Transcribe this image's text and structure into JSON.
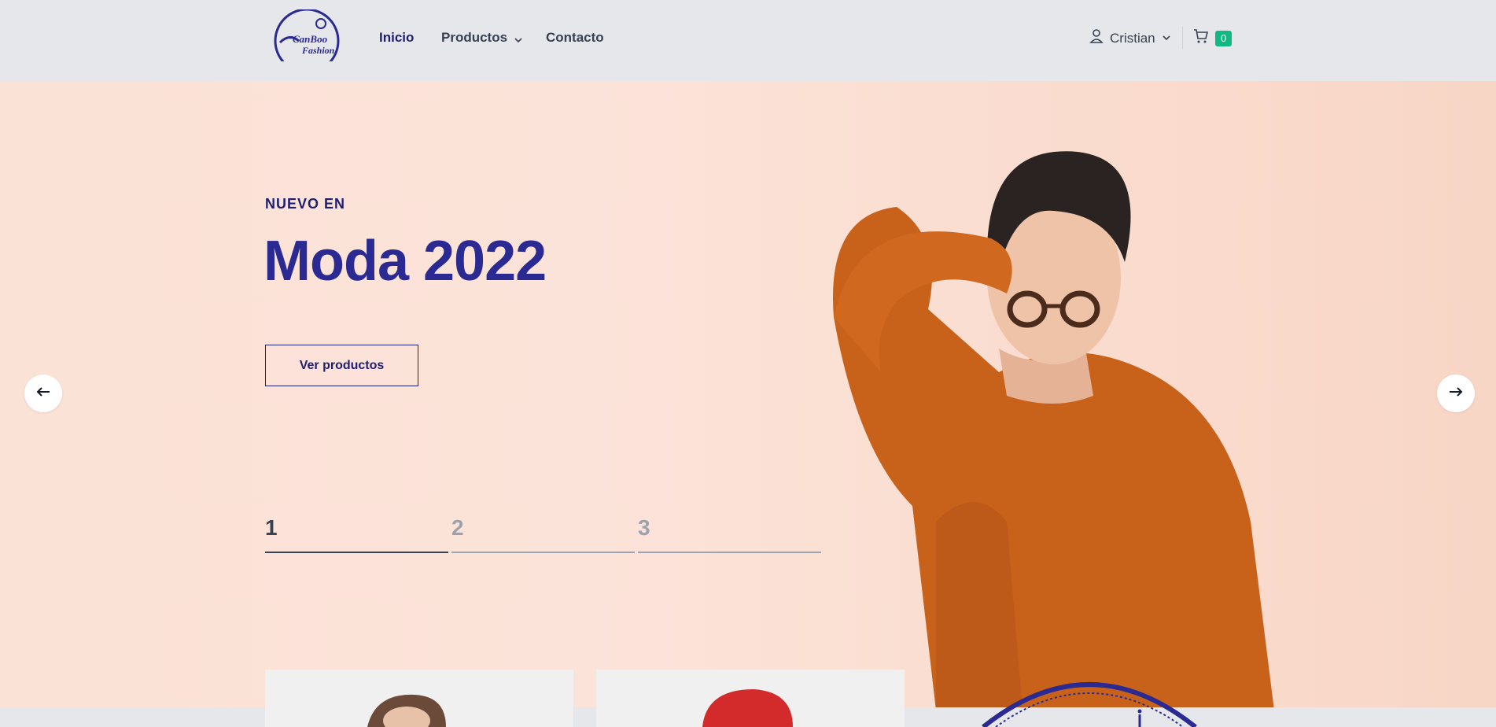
{
  "header": {
    "brand_line1": "Can",
    "brand_line2": "Boo",
    "brand_line3": "Fashion",
    "nav": {
      "inicio": "Inicio",
      "productos": "Productos",
      "contacto": "Contacto"
    },
    "user_name": "Cristian",
    "cart_count": "0"
  },
  "hero": {
    "eyebrow": "NUEVO EN",
    "title": "Moda 2022",
    "cta": "Ver productos",
    "pages": [
      "1",
      "2",
      "3"
    ],
    "active_page": 1
  },
  "icons": {
    "user": "user-icon",
    "cart": "cart-icon",
    "prev": "arrow-left-icon",
    "next": "arrow-right-icon",
    "chevron": "chevron-down-icon"
  },
  "colors": {
    "brand_navy": "#2b2a93",
    "badge_green": "#10b981",
    "hero_bg": "#fbe2d6",
    "header_bg": "#e5e7eb"
  }
}
